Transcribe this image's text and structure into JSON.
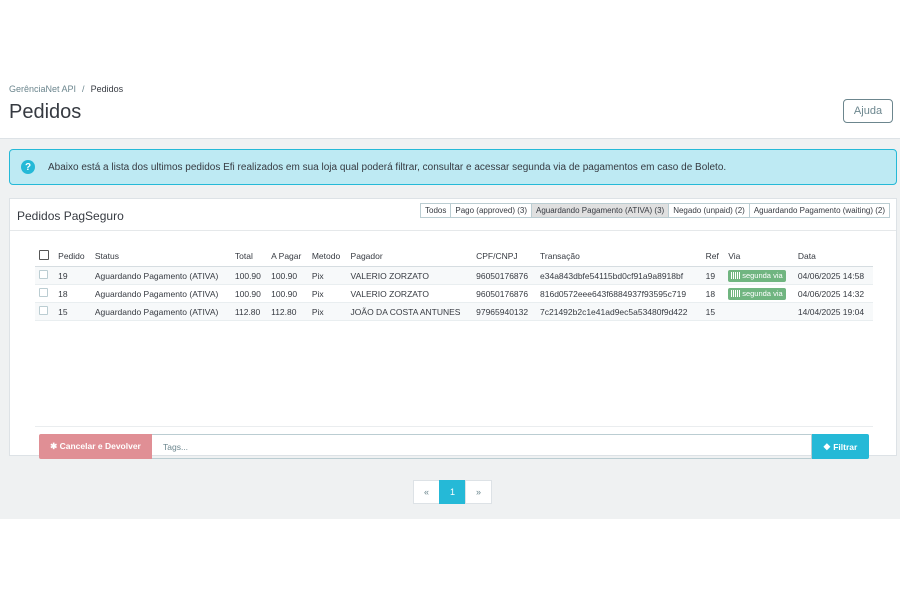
{
  "breadcrumb": {
    "parent": "GerênciaNet API",
    "separator": "/",
    "current": "Pedidos"
  },
  "header": {
    "title": "Pedidos",
    "help_label": "Ajuda"
  },
  "alert": {
    "icon": "?",
    "text": "Abaixo está a lista dos ultimos pedidos Efi realizados em sua loja qual poderá filtrar, consultar e acessar segunda via de pagamentos em caso de Boleto."
  },
  "card": {
    "title": "Pedidos PagSeguro",
    "filters": [
      {
        "label": "Todos",
        "active": false
      },
      {
        "label": "Pago (approved) (3)",
        "active": false
      },
      {
        "label": "Aguardando Pagamento (ATIVA) (3)",
        "active": true
      },
      {
        "label": "Negado (unpaid) (2)",
        "active": false
      },
      {
        "label": "Aguardando Pagamento (waiting) (2)",
        "active": false
      }
    ]
  },
  "table": {
    "columns": [
      "Pedido",
      "Status",
      "Total",
      "A Pagar",
      "Metodo",
      "Pagador",
      "CPF/CNPJ",
      "Transação",
      "Ref",
      "Via",
      "Data"
    ],
    "rows": [
      {
        "pedido": "19",
        "status": "Aguardando Pagamento (ATIVA)",
        "total": "100.90",
        "a_pagar": "100.90",
        "metodo": "Pix",
        "pagador": "VALERIO ZORZATO",
        "cpf": "96050176876",
        "transacao": "e34a843dbfe54115bd0cf91a9a8918bf",
        "ref": "19",
        "via": "segunda via",
        "data": "04/06/2025 14:58"
      },
      {
        "pedido": "18",
        "status": "Aguardando Pagamento (ATIVA)",
        "total": "100.90",
        "a_pagar": "100.90",
        "metodo": "Pix",
        "pagador": "VALERIO ZORZATO",
        "cpf": "96050176876",
        "transacao": "816d0572eee643f6884937f93595c719",
        "ref": "18",
        "via": "segunda via",
        "data": "04/06/2025 14:32"
      },
      {
        "pedido": "15",
        "status": "Aguardando Pagamento (ATIVA)",
        "total": "112.80",
        "a_pagar": "112.80",
        "metodo": "Pix",
        "pagador": "JOÃO DA COSTA ANTUNES",
        "cpf": "97965940132",
        "transacao": "7c21492b2c1e41ad9ec5a53480f9d422",
        "ref": "15",
        "via": "",
        "data": "14/04/2025 19:04"
      }
    ]
  },
  "actions": {
    "cancel_label": "✱ Cancelar e Devolver",
    "tags_placeholder": "Tags...",
    "filter_label": "Filtrar",
    "filter_icon": "tag-icon"
  },
  "pagination": {
    "prev": "«",
    "current": "1",
    "next": "»"
  },
  "colors": {
    "accent": "#25b9d7",
    "danger": "#e08f95",
    "success": "#70b580",
    "alert_bg": "#beeaf3"
  }
}
